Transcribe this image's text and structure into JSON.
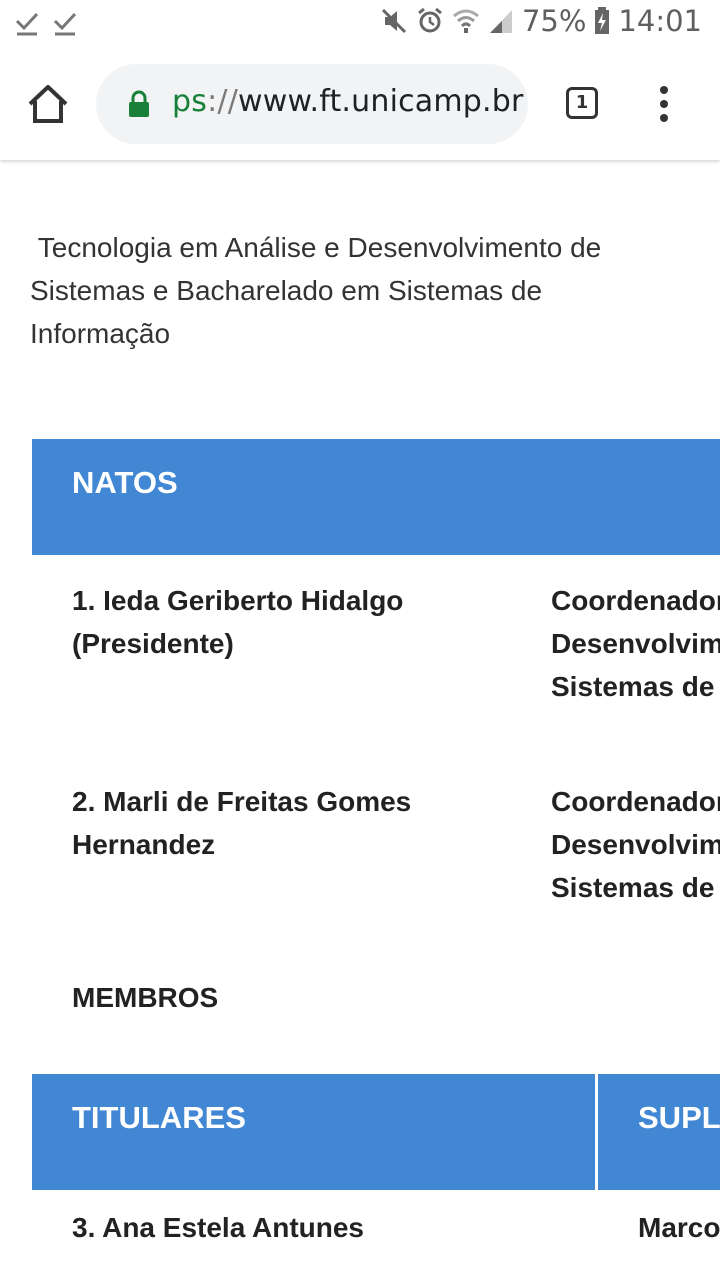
{
  "status_bar": {
    "battery": "75%",
    "time": "14:01"
  },
  "browser": {
    "url_scheme_fragment": "ps",
    "url_separator": "://",
    "url_host": "www.ft.unicamp.br",
    "tab_count": "1"
  },
  "page": {
    "course_title": " Tecnologia em Análise e Desenvolvimento de Sistemas e Bacharelado em Sistemas de Informação",
    "natos": {
      "header": "NATOS",
      "rows": [
        {
          "name": "1. Ieda Geriberto Hidalgo (Presidente)",
          "role_lines": [
            "Coordenador",
            "Desenvolvim",
            "Sistemas de I"
          ]
        },
        {
          "name": "2. Marli de Freitas Gomes Hernandez",
          "role_lines": [
            "Coordenador",
            "Desenvolvim",
            "Sistemas de I"
          ]
        }
      ]
    },
    "membros_label": "MEMBROS",
    "members_table": {
      "col_titulares": "TITULARES",
      "col_suplentes": "SUPLI",
      "first_row": {
        "titular": "3. Ana Estela Antunes",
        "suplente": "Marco"
      }
    }
  },
  "colors": {
    "header_band": "#4287d4",
    "lock_green": "#188038"
  }
}
